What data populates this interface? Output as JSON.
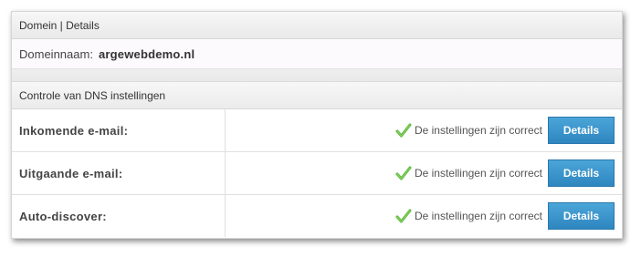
{
  "domain_section": {
    "title": "Domein | Details",
    "domain_label": "Domeinnaam:",
    "domain_value": "argewebdemo.nl"
  },
  "dns_section": {
    "title": "Controle van DNS instellingen",
    "rows": [
      {
        "label": "Inkomende e-mail:",
        "status": "De instellingen zijn correct",
        "button": "Details"
      },
      {
        "label": "Uitgaande e-mail:",
        "status": "De instellingen zijn correct",
        "button": "Details"
      },
      {
        "label": "Auto-discover:",
        "status": "De instellingen zijn correct",
        "button": "Details"
      }
    ]
  },
  "icons": {
    "status_ok": "check-icon"
  },
  "colors": {
    "button": "#3a94cc",
    "check": "#5cb83a"
  }
}
